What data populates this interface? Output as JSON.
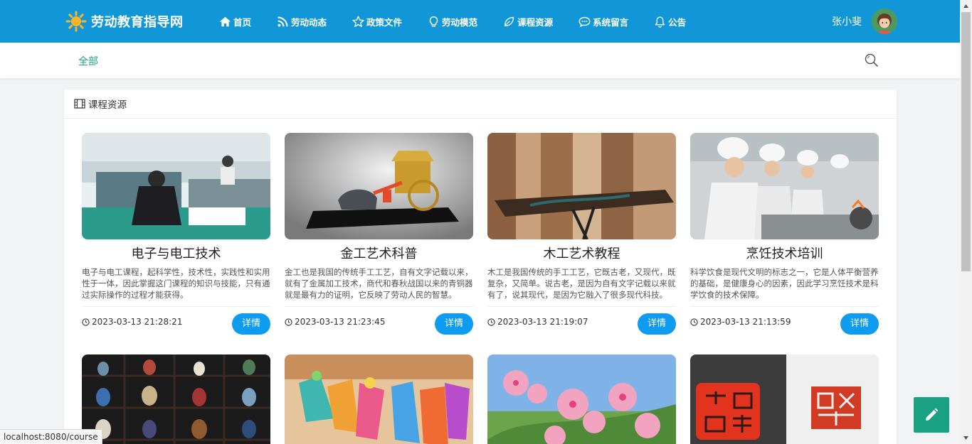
{
  "brand": {
    "title": "劳动教育指导网",
    "icon": "sun-icon"
  },
  "nav": [
    {
      "label": "首页",
      "icon": "home-icon"
    },
    {
      "label": "劳动动态",
      "icon": "rss-icon"
    },
    {
      "label": "政策文件",
      "icon": "star-icon"
    },
    {
      "label": "劳动模范",
      "icon": "lightbulb-icon"
    },
    {
      "label": "课程资源",
      "icon": "leaf-icon"
    },
    {
      "label": "系统留言",
      "icon": "chat-icon"
    },
    {
      "label": "公告",
      "icon": "bell-icon"
    }
  ],
  "user": {
    "name": "张小斐",
    "icon": "avatar"
  },
  "filter": {
    "all_label": "全部",
    "search_icon": "search-icon"
  },
  "panel": {
    "title": "课程资源",
    "icon": "film-icon"
  },
  "courses": [
    {
      "title": "电子与电工技术",
      "desc": "电子与电工课程，起科学性，技术性，实践性和实用性于一体，因此掌握这门课程的知识与技能，只有通过实际操作的过程才能获得。",
      "date": "2023-03-13 21:28:21",
      "button": "详情"
    },
    {
      "title": "金工艺术科普",
      "desc": "金工也是我国的传统手工工艺，自有文字记载以来，就有了金属加工技术，商代和春秋战国以来的青铜器就是最有力的证明，它反映了劳动人民的智慧。",
      "date": "2023-03-13 21:23:45",
      "button": "详情"
    },
    {
      "title": "木工艺术教程",
      "desc": "木工是我国传统的手工工艺，它既古老，又现代，既复杂，又简单。说古老，是因为自有文字记载以来就有了，说其现代，是因为它融入了很多现代科技。",
      "date": "2023-03-13 21:19:07",
      "button": "详情"
    },
    {
      "title": "烹饪技术培训",
      "desc": "科学饮食是现代文明的标志之一，它是人体平衡营养的基础，是健康身心的因素，因此学习烹饪技术是科学饮食的技术保障。",
      "date": "2023-03-13 21:13:59",
      "button": "详情"
    }
  ],
  "status_url": "localhost:8080/course",
  "colors": {
    "nav": "#1197d8",
    "accent": "#19a974",
    "button": "#0e9bf0",
    "fab": "#1aa083"
  }
}
